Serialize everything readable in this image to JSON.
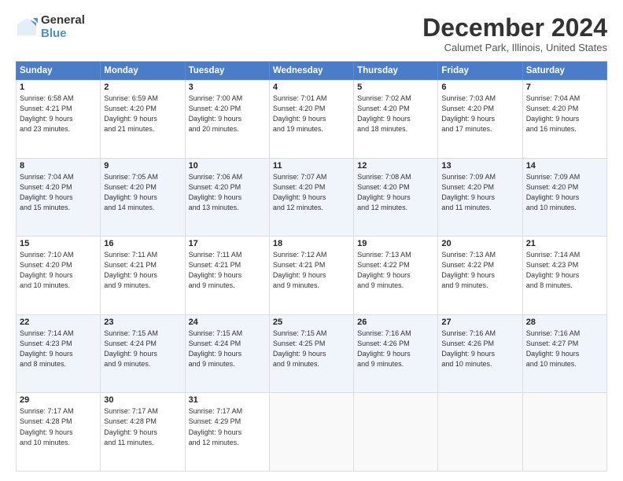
{
  "header": {
    "logo_general": "General",
    "logo_blue": "Blue",
    "month_title": "December 2024",
    "subtitle": "Calumet Park, Illinois, United States"
  },
  "days_of_week": [
    "Sunday",
    "Monday",
    "Tuesday",
    "Wednesday",
    "Thursday",
    "Friday",
    "Saturday"
  ],
  "weeks": [
    [
      {
        "day": "1",
        "lines": [
          "Sunrise: 6:58 AM",
          "Sunset: 4:21 PM",
          "Daylight: 9 hours",
          "and 23 minutes."
        ]
      },
      {
        "day": "2",
        "lines": [
          "Sunrise: 6:59 AM",
          "Sunset: 4:20 PM",
          "Daylight: 9 hours",
          "and 21 minutes."
        ]
      },
      {
        "day": "3",
        "lines": [
          "Sunrise: 7:00 AM",
          "Sunset: 4:20 PM",
          "Daylight: 9 hours",
          "and 20 minutes."
        ]
      },
      {
        "day": "4",
        "lines": [
          "Sunrise: 7:01 AM",
          "Sunset: 4:20 PM",
          "Daylight: 9 hours",
          "and 19 minutes."
        ]
      },
      {
        "day": "5",
        "lines": [
          "Sunrise: 7:02 AM",
          "Sunset: 4:20 PM",
          "Daylight: 9 hours",
          "and 18 minutes."
        ]
      },
      {
        "day": "6",
        "lines": [
          "Sunrise: 7:03 AM",
          "Sunset: 4:20 PM",
          "Daylight: 9 hours",
          "and 17 minutes."
        ]
      },
      {
        "day": "7",
        "lines": [
          "Sunrise: 7:04 AM",
          "Sunset: 4:20 PM",
          "Daylight: 9 hours",
          "and 16 minutes."
        ]
      }
    ],
    [
      {
        "day": "8",
        "lines": [
          "Sunrise: 7:04 AM",
          "Sunset: 4:20 PM",
          "Daylight: 9 hours",
          "and 15 minutes."
        ]
      },
      {
        "day": "9",
        "lines": [
          "Sunrise: 7:05 AM",
          "Sunset: 4:20 PM",
          "Daylight: 9 hours",
          "and 14 minutes."
        ]
      },
      {
        "day": "10",
        "lines": [
          "Sunrise: 7:06 AM",
          "Sunset: 4:20 PM",
          "Daylight: 9 hours",
          "and 13 minutes."
        ]
      },
      {
        "day": "11",
        "lines": [
          "Sunrise: 7:07 AM",
          "Sunset: 4:20 PM",
          "Daylight: 9 hours",
          "and 12 minutes."
        ]
      },
      {
        "day": "12",
        "lines": [
          "Sunrise: 7:08 AM",
          "Sunset: 4:20 PM",
          "Daylight: 9 hours",
          "and 12 minutes."
        ]
      },
      {
        "day": "13",
        "lines": [
          "Sunrise: 7:09 AM",
          "Sunset: 4:20 PM",
          "Daylight: 9 hours",
          "and 11 minutes."
        ]
      },
      {
        "day": "14",
        "lines": [
          "Sunrise: 7:09 AM",
          "Sunset: 4:20 PM",
          "Daylight: 9 hours",
          "and 10 minutes."
        ]
      }
    ],
    [
      {
        "day": "15",
        "lines": [
          "Sunrise: 7:10 AM",
          "Sunset: 4:20 PM",
          "Daylight: 9 hours",
          "and 10 minutes."
        ]
      },
      {
        "day": "16",
        "lines": [
          "Sunrise: 7:11 AM",
          "Sunset: 4:21 PM",
          "Daylight: 9 hours",
          "and 9 minutes."
        ]
      },
      {
        "day": "17",
        "lines": [
          "Sunrise: 7:11 AM",
          "Sunset: 4:21 PM",
          "Daylight: 9 hours",
          "and 9 minutes."
        ]
      },
      {
        "day": "18",
        "lines": [
          "Sunrise: 7:12 AM",
          "Sunset: 4:21 PM",
          "Daylight: 9 hours",
          "and 9 minutes."
        ]
      },
      {
        "day": "19",
        "lines": [
          "Sunrise: 7:13 AM",
          "Sunset: 4:22 PM",
          "Daylight: 9 hours",
          "and 9 minutes."
        ]
      },
      {
        "day": "20",
        "lines": [
          "Sunrise: 7:13 AM",
          "Sunset: 4:22 PM",
          "Daylight: 9 hours",
          "and 9 minutes."
        ]
      },
      {
        "day": "21",
        "lines": [
          "Sunrise: 7:14 AM",
          "Sunset: 4:23 PM",
          "Daylight: 9 hours",
          "and 8 minutes."
        ]
      }
    ],
    [
      {
        "day": "22",
        "lines": [
          "Sunrise: 7:14 AM",
          "Sunset: 4:23 PM",
          "Daylight: 9 hours",
          "and 8 minutes."
        ]
      },
      {
        "day": "23",
        "lines": [
          "Sunrise: 7:15 AM",
          "Sunset: 4:24 PM",
          "Daylight: 9 hours",
          "and 9 minutes."
        ]
      },
      {
        "day": "24",
        "lines": [
          "Sunrise: 7:15 AM",
          "Sunset: 4:24 PM",
          "Daylight: 9 hours",
          "and 9 minutes."
        ]
      },
      {
        "day": "25",
        "lines": [
          "Sunrise: 7:15 AM",
          "Sunset: 4:25 PM",
          "Daylight: 9 hours",
          "and 9 minutes."
        ]
      },
      {
        "day": "26",
        "lines": [
          "Sunrise: 7:16 AM",
          "Sunset: 4:26 PM",
          "Daylight: 9 hours",
          "and 9 minutes."
        ]
      },
      {
        "day": "27",
        "lines": [
          "Sunrise: 7:16 AM",
          "Sunset: 4:26 PM",
          "Daylight: 9 hours",
          "and 10 minutes."
        ]
      },
      {
        "day": "28",
        "lines": [
          "Sunrise: 7:16 AM",
          "Sunset: 4:27 PM",
          "Daylight: 9 hours",
          "and 10 minutes."
        ]
      }
    ],
    [
      {
        "day": "29",
        "lines": [
          "Sunrise: 7:17 AM",
          "Sunset: 4:28 PM",
          "Daylight: 9 hours",
          "and 10 minutes."
        ]
      },
      {
        "day": "30",
        "lines": [
          "Sunrise: 7:17 AM",
          "Sunset: 4:28 PM",
          "Daylight: 9 hours",
          "and 11 minutes."
        ]
      },
      {
        "day": "31",
        "lines": [
          "Sunrise: 7:17 AM",
          "Sunset: 4:29 PM",
          "Daylight: 9 hours",
          "and 12 minutes."
        ]
      },
      null,
      null,
      null,
      null
    ]
  ]
}
